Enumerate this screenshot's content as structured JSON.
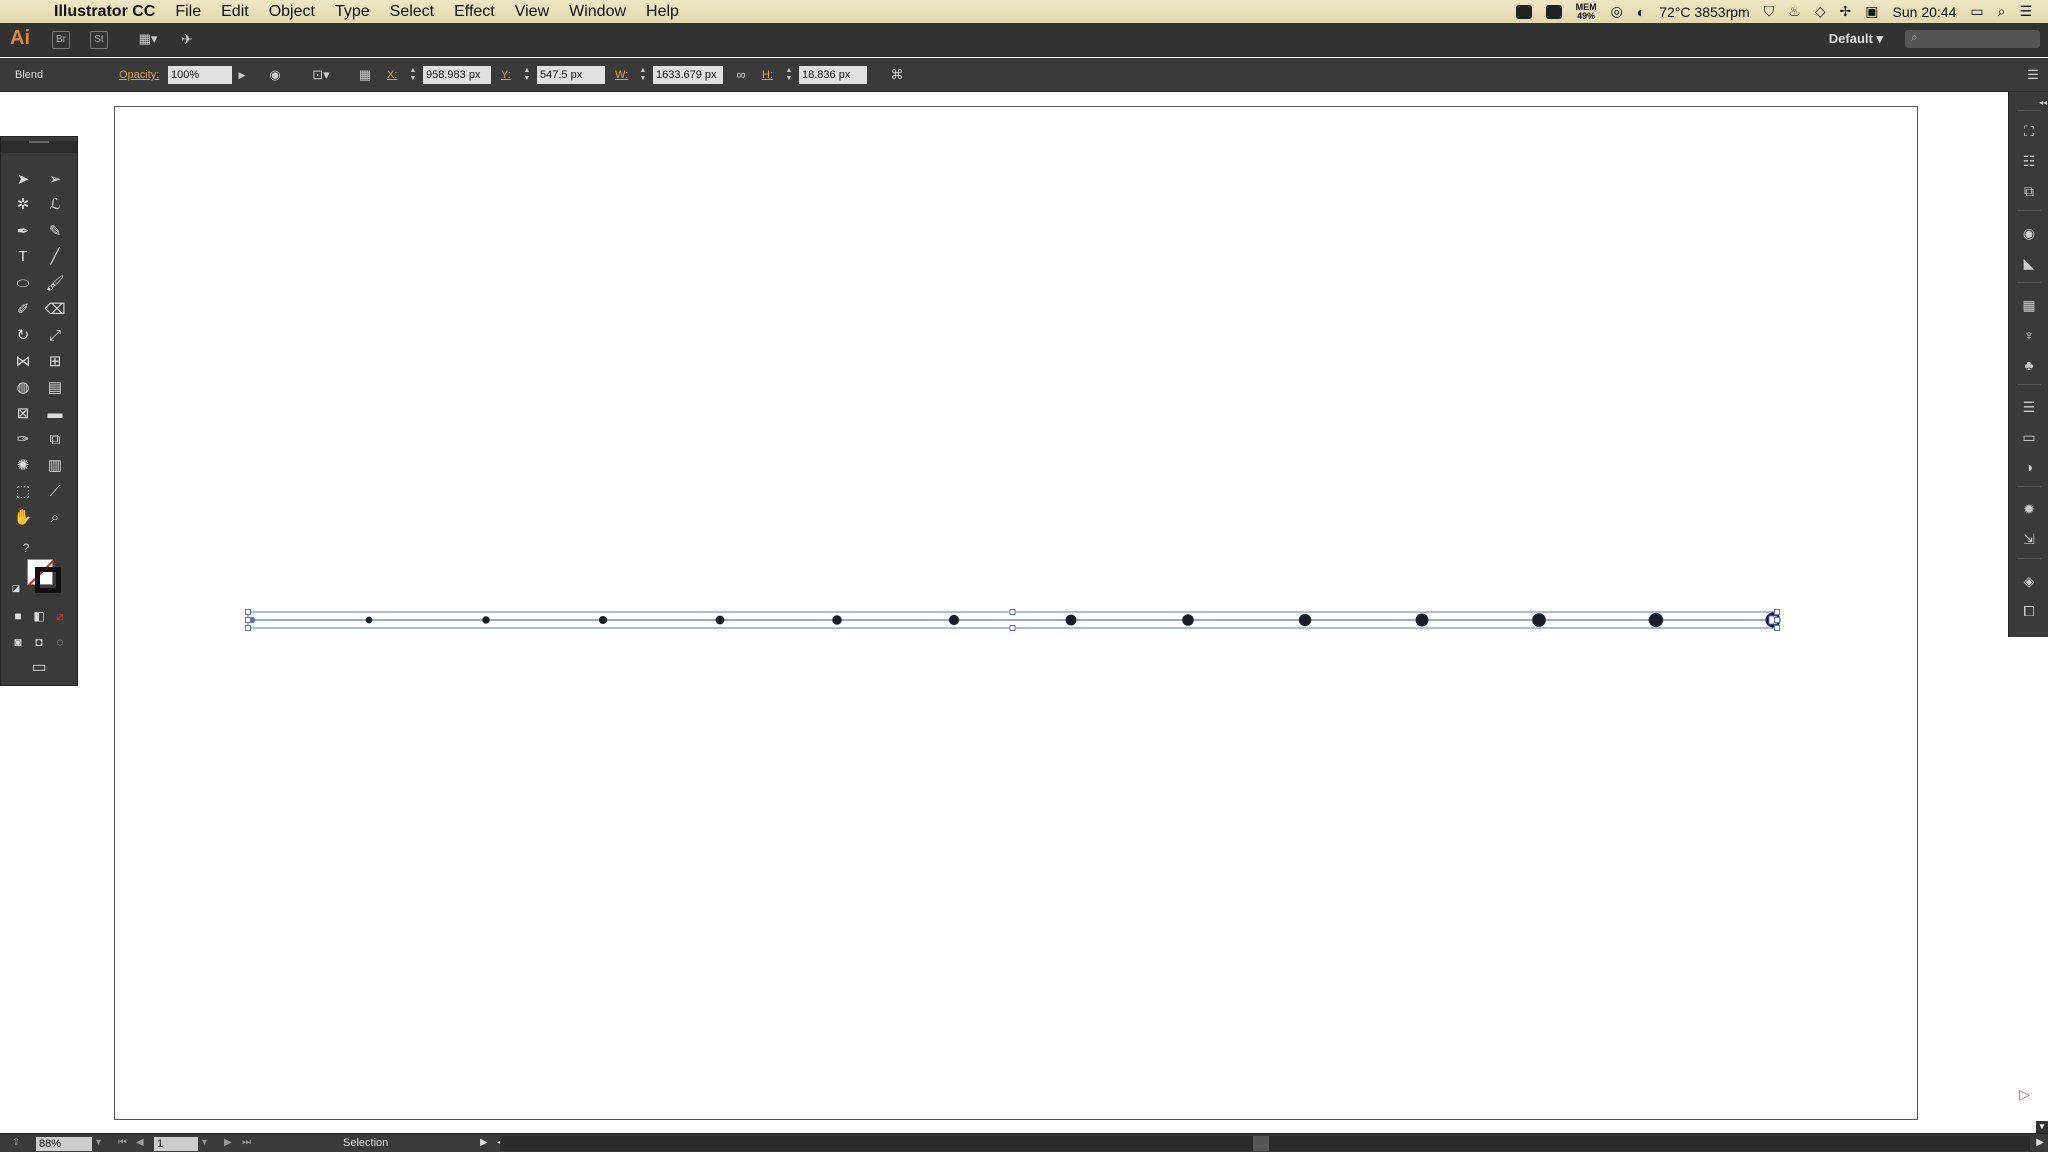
{
  "menubar": {
    "app_name": "Illustrator CC",
    "menus": [
      "File",
      "Edit",
      "Object",
      "Type",
      "Select",
      "Effect",
      "View",
      "Window",
      "Help"
    ],
    "status": {
      "mem_label": "MEM",
      "mem_value": "49%",
      "temp": "72°C 3853rpm",
      "clock": "Sun 20:44"
    }
  },
  "appbar": {
    "logo": "Ai",
    "bridge_label": "Br",
    "stock_label": "St",
    "workspace": "Default",
    "search_placeholder": ""
  },
  "controlbar": {
    "selection_type": "Blend",
    "opacity_label": "Opacity:",
    "opacity_value": "100%",
    "x_label": "X:",
    "x_value": "958.983 px",
    "y_label": "Y:",
    "y_value": "547.5 px",
    "w_label": "W:",
    "w_value": "1633.679 px",
    "h_label": "H:",
    "h_value": "18.836 px"
  },
  "statusbar": {
    "zoom": "88%",
    "page": "1",
    "tool_status": "Selection"
  },
  "blend": {
    "steps": 14,
    "dot_color": "#1c1d2a",
    "selection_color": "#5a6fd6"
  }
}
